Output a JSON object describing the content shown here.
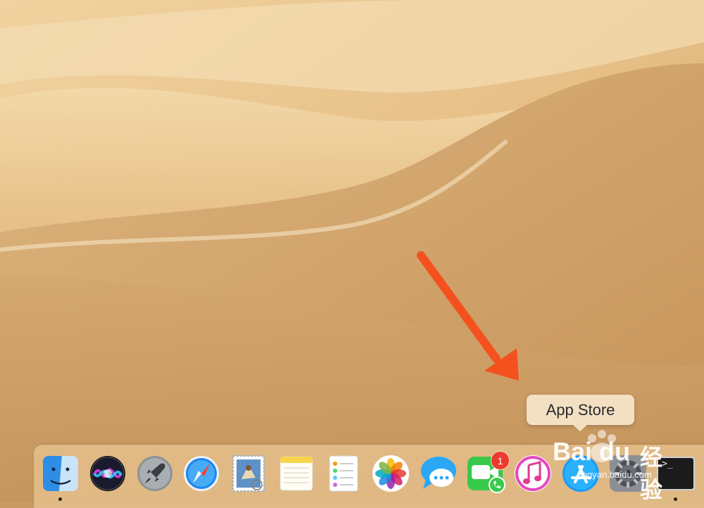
{
  "tooltip": {
    "text": "App Store"
  },
  "dock": {
    "items": [
      {
        "name": "Finder",
        "icon": "finder-icon",
        "running": true
      },
      {
        "name": "Siri",
        "icon": "siri-icon",
        "running": false
      },
      {
        "name": "Launchpad",
        "icon": "launchpad-icon",
        "running": false
      },
      {
        "name": "Safari",
        "icon": "safari-icon",
        "running": false
      },
      {
        "name": "Mail",
        "icon": "mail-icon",
        "running": false
      },
      {
        "name": "Notes",
        "icon": "notes-icon",
        "running": false
      },
      {
        "name": "Reminders",
        "icon": "reminders-icon",
        "running": false
      },
      {
        "name": "Photos",
        "icon": "photos-icon",
        "running": false
      },
      {
        "name": "Messages",
        "icon": "messages-icon",
        "running": false
      },
      {
        "name": "FaceTime",
        "icon": "facetime-icon",
        "running": false,
        "badge": "1"
      },
      {
        "name": "iTunes",
        "icon": "itunes-icon",
        "running": false
      },
      {
        "name": "App Store",
        "icon": "app-store-icon",
        "running": false
      },
      {
        "name": "System Preferences",
        "icon": "system-preferences-icon",
        "running": false
      },
      {
        "name": "Terminal",
        "icon": "terminal-icon",
        "running": true
      }
    ],
    "facetime_badge": "1",
    "terminal_prompt": ">_"
  },
  "watermark": {
    "logo": "Bai du",
    "cn": "经验",
    "url": "jingyan.baidu.com"
  },
  "colors": {
    "arrow": "#f4511e",
    "sand_light": "#f2d7a6",
    "sand_dark": "#c08e55"
  }
}
